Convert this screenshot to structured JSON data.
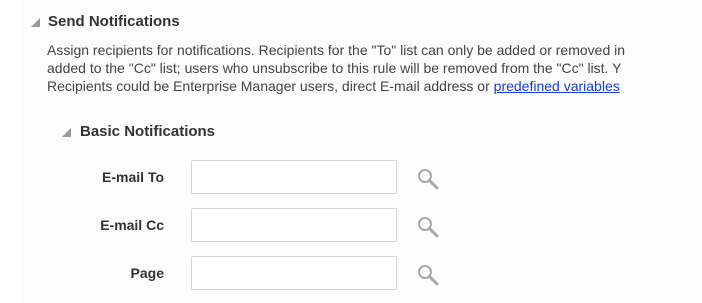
{
  "send_notifications": {
    "title": "Send Notifications",
    "description": {
      "line1": "Assign recipients for notifications. Recipients for the \"To\" list can only be added or removed in",
      "line2": "added to the \"Cc\" list; users who unsubscribe to this rule will be removed from the \"Cc\" list. Y",
      "line3_prefix": "Recipients could be Enterprise Manager users, direct E-mail address or ",
      "line3_link": "predefined variables"
    }
  },
  "basic_notifications": {
    "title": "Basic Notifications",
    "fields": [
      {
        "label": "E-mail To",
        "value": "",
        "icon": "search-icon"
      },
      {
        "label": "E-mail Cc",
        "value": "",
        "icon": "search-icon"
      },
      {
        "label": "Page",
        "value": "",
        "icon": "search-icon"
      }
    ]
  },
  "colors": {
    "link": "#1a3cd6",
    "text": "#333333",
    "input_border": "#d6d6d6",
    "disclosure": "#9a9a9a"
  }
}
